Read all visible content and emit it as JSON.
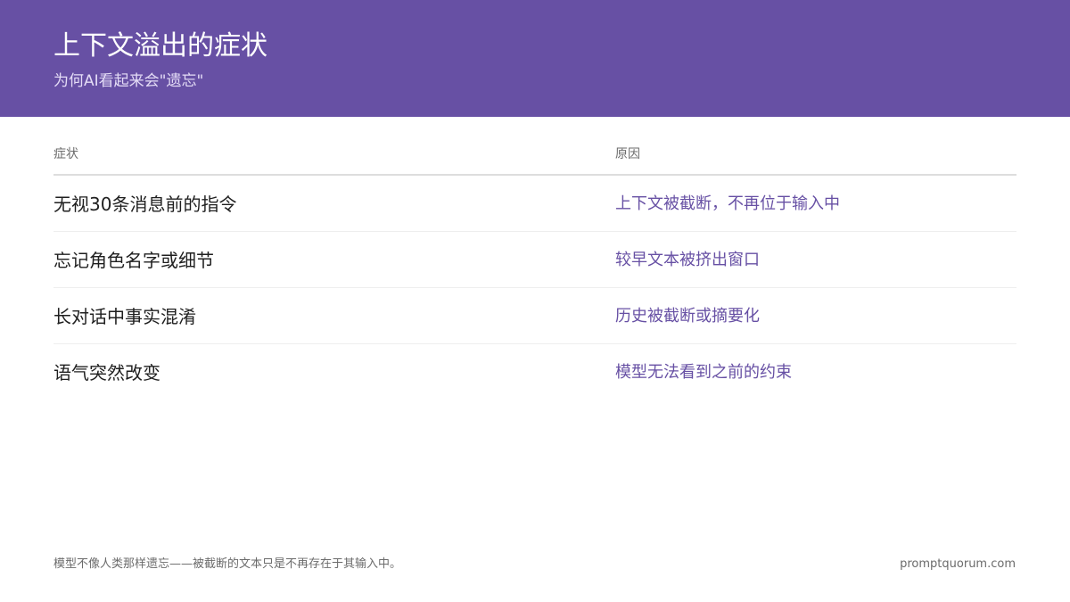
{
  "header": {
    "title": "上下文溢出的症状",
    "subtitle": "为何AI看起来会\"遗忘\""
  },
  "table": {
    "columns": [
      "症状",
      "原因"
    ],
    "rows": [
      {
        "symptom": "无视30条消息前的指令",
        "reason": "上下文被截断，不再位于输入中"
      },
      {
        "symptom": "忘记角色名字或细节",
        "reason": "较早文本被挤出窗口"
      },
      {
        "symptom": "长对话中事实混淆",
        "reason": "历史被截断或摘要化"
      },
      {
        "symptom": "语气突然改变",
        "reason": "模型无法看到之前的约束"
      }
    ]
  },
  "footer": {
    "note": "模型不像人类那样遗忘——被截断的文本只是不再存在于其输入中。",
    "site": "promptquorum.com"
  },
  "colors": {
    "brand": "#6750a4",
    "reason_text": "#6750a4"
  }
}
